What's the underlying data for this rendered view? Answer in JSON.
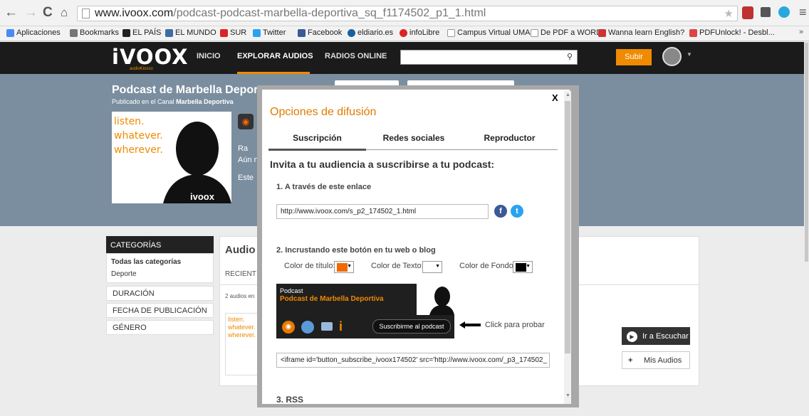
{
  "browser": {
    "url_host": "www.ivoox.com",
    "url_path": "/podcast-podcast-marbella-deportiva_sq_f1174502_p1_1.html",
    "bookmarks": [
      "Aplicaciones",
      "Bookmarks",
      "EL PAÍS",
      "EL MUNDO",
      "SUR",
      "Twitter",
      "Facebook",
      "eldiario.es",
      "infoLibre",
      "Campus Virtual UMA",
      "De PDF a WORD",
      "Wanna learn English?",
      "PDFUnlock! - Desbl..."
    ]
  },
  "site": {
    "logo": "iVOOX",
    "logo_sub": "audioKiosco",
    "nav": [
      "INICIO",
      "EXPLORAR AUDIOS",
      "RADIOS ONLINE"
    ],
    "upload_label": "Subir"
  },
  "podcast": {
    "title": "Podcast de Marbella Deport",
    "channel_prefix": "Publicado en el Canal ",
    "channel_name": "Marbella Deportiva",
    "cover_lines": [
      "listen.",
      "whatever.",
      "wherever."
    ],
    "cover_brand": "ivoox",
    "side_text": [
      "Ra",
      "Aún n",
      "Este"
    ]
  },
  "sidebar": {
    "categories_header": "CATEGORÍAS",
    "categories": [
      "Todas las categorías",
      "Deporte"
    ],
    "filters": [
      "DURACIÓN",
      "FECHA DE PUBLICACIÓN",
      "GÉNERO"
    ]
  },
  "main": {
    "heading": "Audio",
    "tab": "RECIENT",
    "count": "2 audios en",
    "item_cover_lines": [
      "listen.",
      "whatever.",
      "wherever."
    ],
    "go_listen": "Ir a Escuchar",
    "my_audios": "Mis Audios"
  },
  "modal": {
    "title": "Opciones de difusión",
    "close": "X",
    "tabs": [
      "Suscripción",
      "Redes sociales",
      "Reproductor"
    ],
    "invite": "Invita a tu audiencia a suscribirse a tu podcast:",
    "section1": "1. A través de este enlace",
    "link_value": "http://www.ivoox.com/s_p2_174502_1.html",
    "section2": "2. Incrustando este botón en tu web o blog",
    "color_title_label": "Color de título:",
    "color_text_label": "Color de Texto:",
    "color_bg_label": "Color de Fondo:",
    "colors": {
      "title": "#f06a00",
      "text": "#ffffff",
      "bg": "#000000"
    },
    "widget_label": "Podcast",
    "widget_title": "Podcast de Marbella Deportiva",
    "subscribe_label": "Suscribirme al podcast",
    "click_hint": "Click para probar",
    "iframe_code": "<iframe id='button_subscribe_ivoox174502' src='http://www.ivoox.com/_p3_174502_",
    "section3": "3. RSS"
  }
}
